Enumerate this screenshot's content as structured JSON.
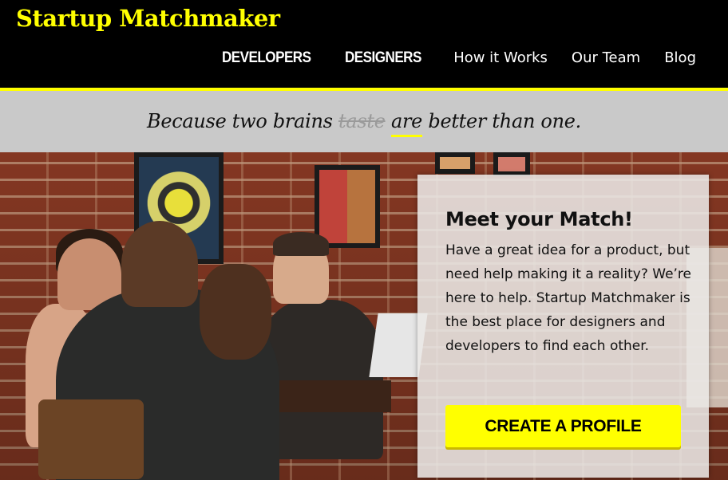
{
  "header": {
    "brand": "Startup Matchmaker",
    "nav": [
      {
        "label": "DEVELOPERS"
      },
      {
        "label": "DESIGNERS"
      },
      {
        "label": "How it Works"
      },
      {
        "label": "Our Team"
      },
      {
        "label": "Blog"
      }
    ]
  },
  "tagline": {
    "before": "Because two brains ",
    "struck": "taste",
    "underlined": "are",
    "after": " better than one."
  },
  "card": {
    "title": "Meet your Match!",
    "body": "Have a great idea for a product, but need help making it a reality? We’re here to help. Startup Matchmaker is the best place for designers and developers to find each other.",
    "cta": "CREATE A PROFILE"
  },
  "colors": {
    "accent": "#ffff00",
    "header_bg": "#000000",
    "tagline_bg": "#c9c9c9"
  }
}
